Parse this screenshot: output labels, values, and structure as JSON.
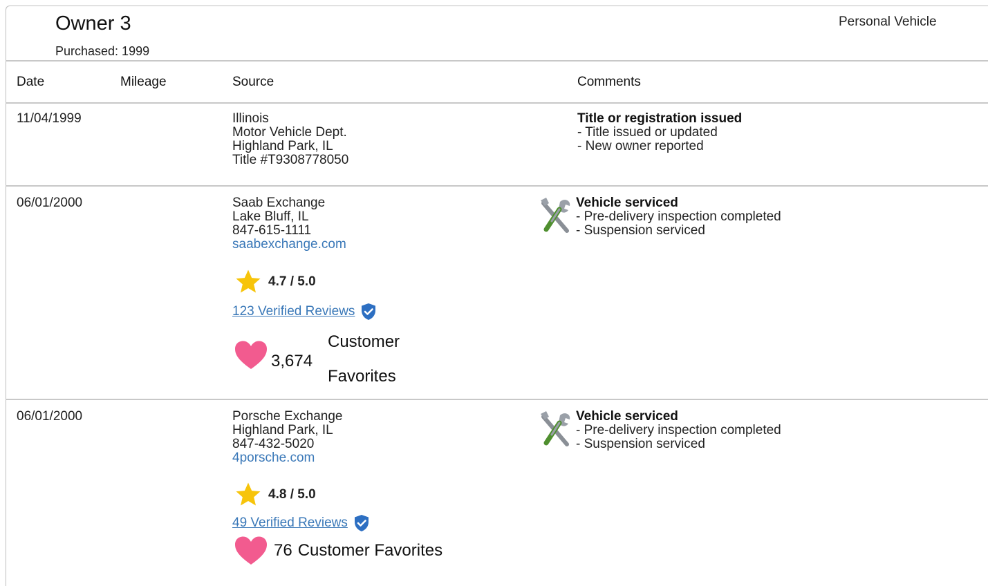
{
  "owner": {
    "title": "Owner 3",
    "purchased": "Purchased: 1999",
    "vehicle_type": "Personal Vehicle"
  },
  "table": {
    "headers": [
      "Date",
      "Mileage",
      "Source",
      "Comments"
    ],
    "rows": [
      {
        "date": "11/04/1999",
        "mileage": "",
        "source": [
          "Illinois",
          "Motor Vehicle Dept.",
          "Highland Park, IL",
          "Title #T9308778050"
        ],
        "comment_title": "Title or registration issued",
        "comment_items": [
          "- Title issued or updated",
          "- New owner reported"
        ]
      },
      {
        "date": "06/01/2000",
        "mileage": "",
        "source": [
          "Saab Exchange",
          "Lake Bluff, IL",
          "847-615-1111"
        ],
        "website": "saabexchange.com",
        "rating": "4.7 / 5.0",
        "reviews": "123 Verified Reviews",
        "favorites_count": "3,674",
        "favorites_label_1": "Customer",
        "favorites_label_2": "Favorites",
        "comment_icon": "tools-icon",
        "comment_title": "Vehicle serviced",
        "comment_items": [
          "- Pre-delivery inspection completed",
          "- Suspension serviced"
        ]
      },
      {
        "date": "06/01/2000",
        "mileage": "",
        "source": [
          "Porsche Exchange",
          "Highland Park, IL",
          "847-432-5020"
        ],
        "website": "4porsche.com",
        "rating": "4.8 / 5.0",
        "reviews": "49 Verified Reviews",
        "favorites_count": "76",
        "favorites_label": "Customer Favorites",
        "comment_icon": "tools-icon",
        "comment_title": "Vehicle serviced",
        "comment_items": [
          "- Pre-delivery inspection completed",
          "- Suspension serviced"
        ]
      }
    ]
  },
  "colors": {
    "link": "#3a78b8",
    "star": "#f7c40a",
    "heart": "#f25b8f",
    "shield": "#2d6fc2",
    "divider": "#c8c8c8"
  }
}
